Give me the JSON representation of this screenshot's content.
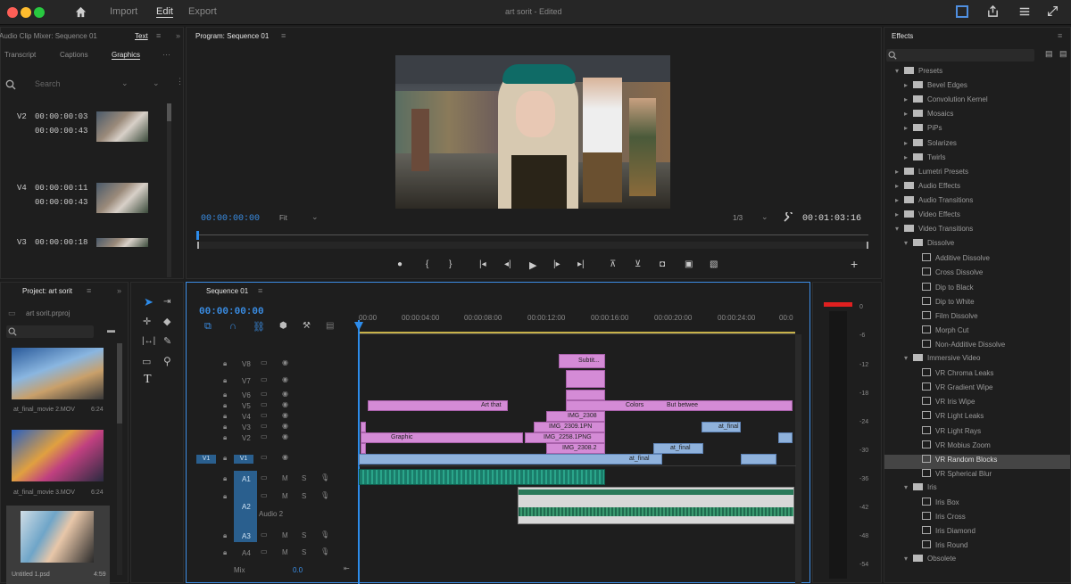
{
  "window": {
    "title": "art sorit",
    "status": "Edited"
  },
  "menu": {
    "import": "Import",
    "edit": "Edit",
    "export": "Export"
  },
  "text_panel": {
    "header_left": "Audio Clip Mixer: Sequence 01",
    "header_tab": "Text",
    "tabs": [
      "Transcript",
      "Captions",
      "Graphics"
    ],
    "search_placeholder": "Search",
    "items": [
      {
        "track": "V2",
        "start": "00:00:00:03",
        "end": "00:00:00:43"
      },
      {
        "track": "V4",
        "start": "00:00:00:11",
        "end": "00:00:00:43"
      },
      {
        "track": "V3",
        "start": "00:00:00:18",
        "end": ""
      }
    ]
  },
  "program": {
    "header": "Program: Sequence 01",
    "timecode": "00:00:00:00",
    "fit": "Fit",
    "quality": "1/3",
    "duration": "00:01:03:16"
  },
  "project": {
    "header": "Project: art sorit",
    "file": "art sorit.prproj",
    "items": [
      {
        "name": "at_final_movie 2.MOV",
        "dur": "6:24"
      },
      {
        "name": "at_final_movie 3.MOV",
        "dur": "6:24"
      },
      {
        "name": "Untitled 1.psd",
        "dur": "4:59"
      }
    ]
  },
  "sequence": {
    "tab": "Sequence 01",
    "timecode": "00:00:00:00",
    "ruler": [
      "00:00",
      "00:00:04:00",
      "00:00:08:00",
      "00:00:12:00",
      "00:00:16:00",
      "00:00:20:00",
      "00:00:24:00",
      "00:0"
    ],
    "video_tracks": [
      "V8",
      "V7",
      "V6",
      "V5",
      "V4",
      "V3",
      "V2",
      "V1"
    ],
    "source_v": "V1",
    "audio_tracks": [
      "A1",
      "A2",
      "A3",
      "A4"
    ],
    "audio2_label": "Audio 2",
    "mix_label": "Mix",
    "mix_value": "0.0",
    "clip_labels": {
      "subtitle": "Subtit...",
      "graphic": "Graphic",
      "artthat": "Art that",
      "colors": "Colors",
      "butbetween": "But betwee",
      "img1": "IMG_2308",
      "img2": "IMG_2309.1PN",
      "img3": "IMG_2258.1PNG",
      "img4": "IMG_2308.2",
      "atfinal": "at_final",
      "atfinal2": "at_final",
      "atfinal3": "at_final"
    }
  },
  "meter": {
    "scale": [
      "0",
      "-6",
      "-12",
      "-18",
      "-24",
      "-30",
      "-36",
      "-42",
      "-48",
      "-54"
    ]
  },
  "effects": {
    "header": "Effects",
    "tree": [
      {
        "lvl": 0,
        "type": "folder",
        "open": true,
        "label": "Presets"
      },
      {
        "lvl": 1,
        "type": "folder",
        "open": false,
        "label": "Bevel Edges"
      },
      {
        "lvl": 1,
        "type": "folder",
        "open": false,
        "label": "Convolution Kernel"
      },
      {
        "lvl": 1,
        "type": "folder",
        "open": false,
        "label": "Mosaics"
      },
      {
        "lvl": 1,
        "type": "folder",
        "open": false,
        "label": "PiPs"
      },
      {
        "lvl": 1,
        "type": "folder",
        "open": false,
        "label": "Solarizes"
      },
      {
        "lvl": 1,
        "type": "folder",
        "open": false,
        "label": "Twirls"
      },
      {
        "lvl": 0,
        "type": "folder",
        "open": false,
        "label": "Lumetri Presets"
      },
      {
        "lvl": 0,
        "type": "folder",
        "open": false,
        "label": "Audio Effects"
      },
      {
        "lvl": 0,
        "type": "folder",
        "open": false,
        "label": "Audio Transitions"
      },
      {
        "lvl": 0,
        "type": "folder",
        "open": false,
        "label": "Video Effects"
      },
      {
        "lvl": 0,
        "type": "folder",
        "open": true,
        "label": "Video Transitions"
      },
      {
        "lvl": 1,
        "type": "folder",
        "open": true,
        "label": "Dissolve"
      },
      {
        "lvl": 2,
        "type": "fx",
        "label": "Additive Dissolve"
      },
      {
        "lvl": 2,
        "type": "fx",
        "label": "Cross Dissolve"
      },
      {
        "lvl": 2,
        "type": "fx",
        "label": "Dip to Black"
      },
      {
        "lvl": 2,
        "type": "fx",
        "label": "Dip to White"
      },
      {
        "lvl": 2,
        "type": "fx",
        "label": "Film Dissolve"
      },
      {
        "lvl": 2,
        "type": "fx",
        "label": "Morph Cut"
      },
      {
        "lvl": 2,
        "type": "fx",
        "label": "Non-Additive Dissolve"
      },
      {
        "lvl": 1,
        "type": "folder",
        "open": true,
        "label": "Immersive Video"
      },
      {
        "lvl": 2,
        "type": "fx",
        "label": "VR Chroma Leaks"
      },
      {
        "lvl": 2,
        "type": "fx",
        "label": "VR Gradient Wipe"
      },
      {
        "lvl": 2,
        "type": "fx",
        "label": "VR Iris Wipe"
      },
      {
        "lvl": 2,
        "type": "fx",
        "label": "VR Light Leaks"
      },
      {
        "lvl": 2,
        "type": "fx",
        "label": "VR Light Rays"
      },
      {
        "lvl": 2,
        "type": "fx",
        "label": "VR Mobius Zoom"
      },
      {
        "lvl": 2,
        "type": "fx",
        "label": "VR Random Blocks",
        "selected": true
      },
      {
        "lvl": 2,
        "type": "fx",
        "label": "VR Spherical Blur"
      },
      {
        "lvl": 1,
        "type": "folder",
        "open": true,
        "label": "Iris"
      },
      {
        "lvl": 2,
        "type": "fx",
        "label": "Iris Box"
      },
      {
        "lvl": 2,
        "type": "fx",
        "label": "Iris Cross"
      },
      {
        "lvl": 2,
        "type": "fx",
        "label": "Iris Diamond"
      },
      {
        "lvl": 2,
        "type": "fx",
        "label": "Iris Round"
      },
      {
        "lvl": 1,
        "type": "folder",
        "open": true,
        "label": "Obsolete"
      }
    ]
  },
  "colors": {
    "accent": "#2d8ceb",
    "clip_pink": "#d48bd6",
    "clip_blue": "#8fb2dc",
    "audio_green": "#1a7c6a"
  }
}
